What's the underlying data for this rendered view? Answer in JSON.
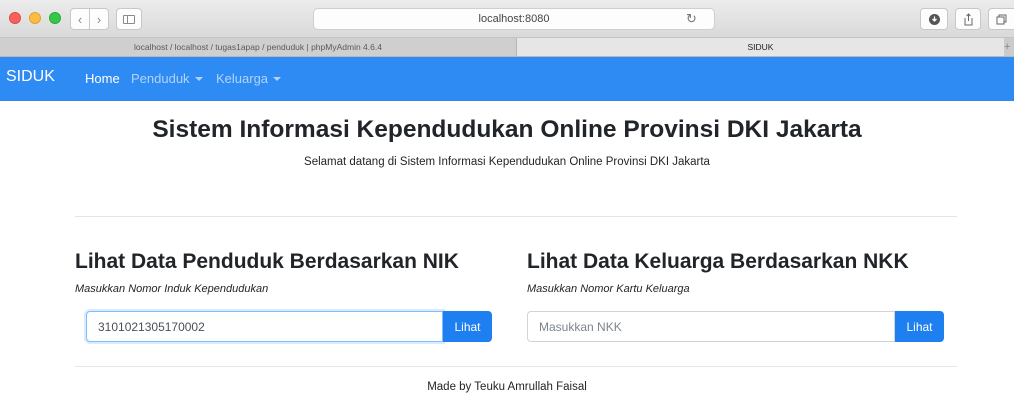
{
  "browser": {
    "address": "localhost:8080",
    "tabs": [
      {
        "label": "localhost / localhost / tugas1apap / penduduk | phpMyAdmin 4.6.4"
      },
      {
        "label": "SIDUK"
      }
    ]
  },
  "navbar": {
    "brand": "SIDUK",
    "items": [
      {
        "label": "Home"
      },
      {
        "label": "Penduduk"
      },
      {
        "label": "Keluarga"
      }
    ]
  },
  "jumbotron": {
    "title": "Sistem Informasi Kependudukan Online Provinsi DKI Jakarta",
    "subtitle": "Selamat datang di Sistem Informasi Kependudukan Online Provinsi DKI Jakarta"
  },
  "nik_section": {
    "title": "Lihat Data Penduduk Berdasarkan NIK",
    "hint": "Masukkan Nomor Induk Kependudukan",
    "value": "3101021305170002",
    "button": "Lihat"
  },
  "nkk_section": {
    "title": "Lihat Data Keluarga Berdasarkan NKK",
    "hint": "Masukkan Nomor Kartu Keluarga",
    "placeholder": "Masukkan NKK",
    "value": "",
    "button": "Lihat"
  },
  "footer": {
    "text": "Made by Teuku Amrullah Faisal"
  },
  "colors": {
    "navbar": "#2e8bf3",
    "button": "#1e7ff0"
  },
  "icons": [
    "back-icon",
    "forward-icon",
    "sidebar-icon",
    "reload-icon",
    "download-icon",
    "share-icon",
    "tabs-icon",
    "caret-down-icon"
  ]
}
